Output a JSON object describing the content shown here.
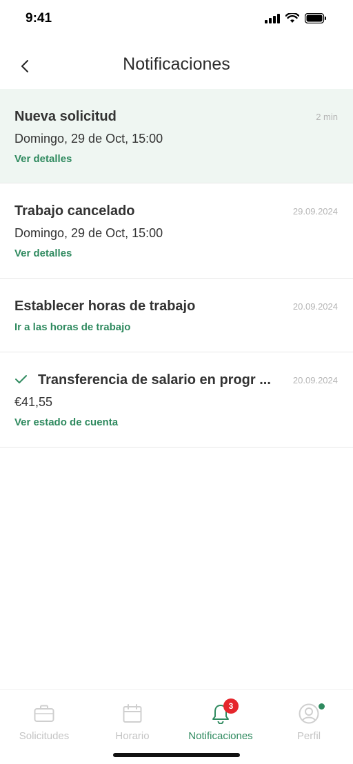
{
  "status_bar": {
    "time": "9:41"
  },
  "header": {
    "title": "Notificaciones"
  },
  "notifications": [
    {
      "title": "Nueva solicitud",
      "date": "2 min",
      "subtitle": "Domingo, 29 de Oct, 15:00",
      "link": "Ver detalles",
      "unread": true
    },
    {
      "title": "Trabajo cancelado",
      "date": "29.09.2024",
      "subtitle": "Domingo, 29 de Oct, 15:00",
      "link": "Ver detalles"
    },
    {
      "title": "Establecer horas de trabajo",
      "date": "20.09.2024",
      "link": "Ir a las horas de trabajo"
    },
    {
      "title": "Transferencia de salario en progr ...",
      "date": "20.09.2024",
      "subtitle": "€41,55",
      "link": "Ver estado de cuenta",
      "icon": "check-icon"
    }
  ],
  "tabs": [
    {
      "label": "Solicitudes",
      "icon": "briefcase-icon"
    },
    {
      "label": "Horario",
      "icon": "calendar-icon"
    },
    {
      "label": "Notificaciones",
      "icon": "bell-icon",
      "badge": "3",
      "active": true
    },
    {
      "label": "Perfil",
      "icon": "profile-icon"
    }
  ],
  "colors": {
    "accent": "#2f8a5f",
    "unread_bg": "#eff6f2",
    "badge": "#e5262c"
  }
}
